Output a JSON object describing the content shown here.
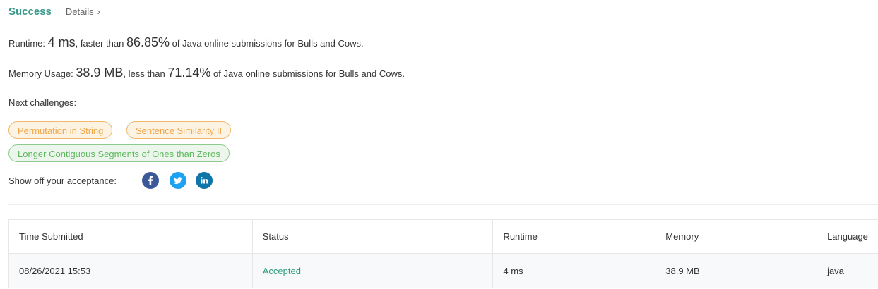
{
  "header": {
    "status": "Success",
    "details_label": "Details",
    "details_chevron": "›"
  },
  "runtime": {
    "label": "Runtime:",
    "value": "4 ms",
    "comparison": ", faster than",
    "percent": "86.85%",
    "suffix": "of Java online submissions for Bulls and Cows."
  },
  "memory": {
    "label": "Memory Usage:",
    "value": "38.9 MB",
    "comparison": ", less than",
    "percent": "71.14%",
    "suffix": "of Java online submissions for Bulls and Cows."
  },
  "next_challenges": {
    "label": "Next challenges:",
    "items": [
      {
        "title": "Permutation in String",
        "difficulty": "medium"
      },
      {
        "title": "Sentence Similarity II",
        "difficulty": "medium"
      },
      {
        "title": "Longer Contiguous Segments of Ones than Zeros",
        "difficulty": "easy"
      }
    ]
  },
  "share": {
    "label": "Show off your acceptance:",
    "icons": [
      "facebook-icon",
      "twitter-icon",
      "linkedin-icon"
    ],
    "colors": {
      "facebook": "#3b5998",
      "twitter": "#1da1f2",
      "linkedin": "#0e76a8"
    }
  },
  "table": {
    "headers": [
      "Time Submitted",
      "Status",
      "Runtime",
      "Memory",
      "Language"
    ],
    "rows": [
      {
        "time": "08/26/2021 15:53",
        "status": "Accepted",
        "runtime": "4 ms",
        "memory": "38.9 MB",
        "language": "java"
      }
    ]
  },
  "colors": {
    "success": "#3a9b8c",
    "accepted": "#2e9c7d",
    "medium": "#f0a64b",
    "easy": "#5cb85c"
  }
}
